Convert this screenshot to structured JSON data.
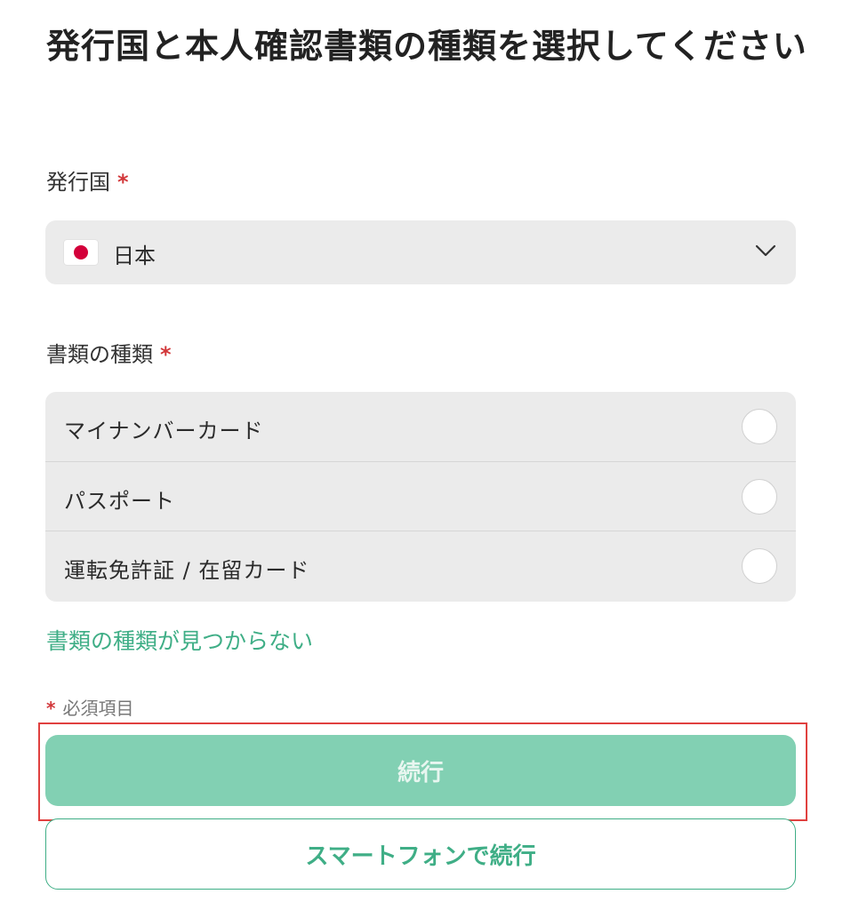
{
  "page": {
    "title": "発行国と本人確認書類の種類を選択してください"
  },
  "country": {
    "label": "発行国",
    "required_mark": "*",
    "selected_value": "日本",
    "flag_icon": "japan-flag-icon"
  },
  "document_type": {
    "label": "書類の種類",
    "required_mark": "*",
    "options": [
      {
        "label": "マイナンバーカード",
        "selected": false
      },
      {
        "label": "パスポート",
        "selected": false
      },
      {
        "label": "運転免許証 / 在留カード",
        "selected": false
      }
    ],
    "not_found_link": "書類の種類が見つからない"
  },
  "footer": {
    "required_note_mark": "*",
    "required_note": "必須項目",
    "continue_label": "続行",
    "smartphone_label": "スマートフォンで続行"
  },
  "colors": {
    "accent": "#3fae86",
    "primary_button": "#82d0b3",
    "required": "#d2373a",
    "highlight_box": "#e0403f"
  }
}
